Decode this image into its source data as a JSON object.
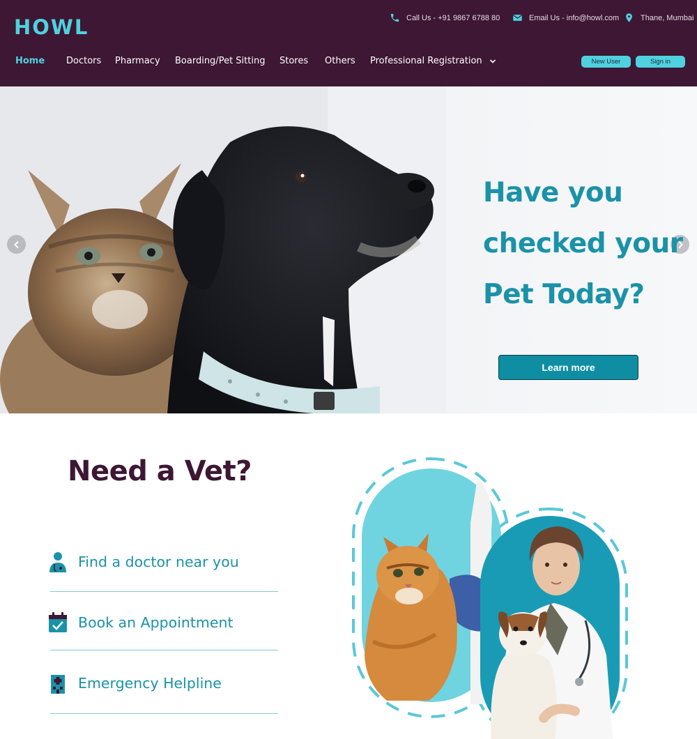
{
  "header": {
    "logo": "HOWL",
    "contact": {
      "phone": "Call Us - +91 9867 6788 80",
      "email": "Email Us - info@howl.com",
      "location": "Thane, Mumbai"
    },
    "nav": [
      {
        "label": "Home",
        "active": true
      },
      {
        "label": "Doctors"
      },
      {
        "label": "Pharmacy"
      },
      {
        "label": "Boarding/Pet Sitting"
      },
      {
        "label": "Stores"
      },
      {
        "label": "Others"
      },
      {
        "label": "Professional Registration",
        "has_dropdown": true
      }
    ],
    "buttons": {
      "new_user": "New User",
      "sign_in": "Sign in"
    }
  },
  "hero": {
    "title_lines": [
      "Have you",
      "checked your",
      "Pet Today?"
    ],
    "cta": "Learn more"
  },
  "vet_section": {
    "title": "Need a Vet?",
    "services": [
      {
        "label": "Find a doctor near you",
        "icon": "doctor-icon"
      },
      {
        "label": "Book an Appointment",
        "icon": "calendar-check-icon"
      },
      {
        "label": "Emergency Helpline",
        "icon": "hospital-icon"
      }
    ]
  },
  "colors": {
    "header_bg": "#3d1733",
    "accent_cyan": "#4fd1df",
    "teal_text": "#1a92a8",
    "cta_bg": "#0f8ea3",
    "heading_plum": "#3d1733"
  }
}
